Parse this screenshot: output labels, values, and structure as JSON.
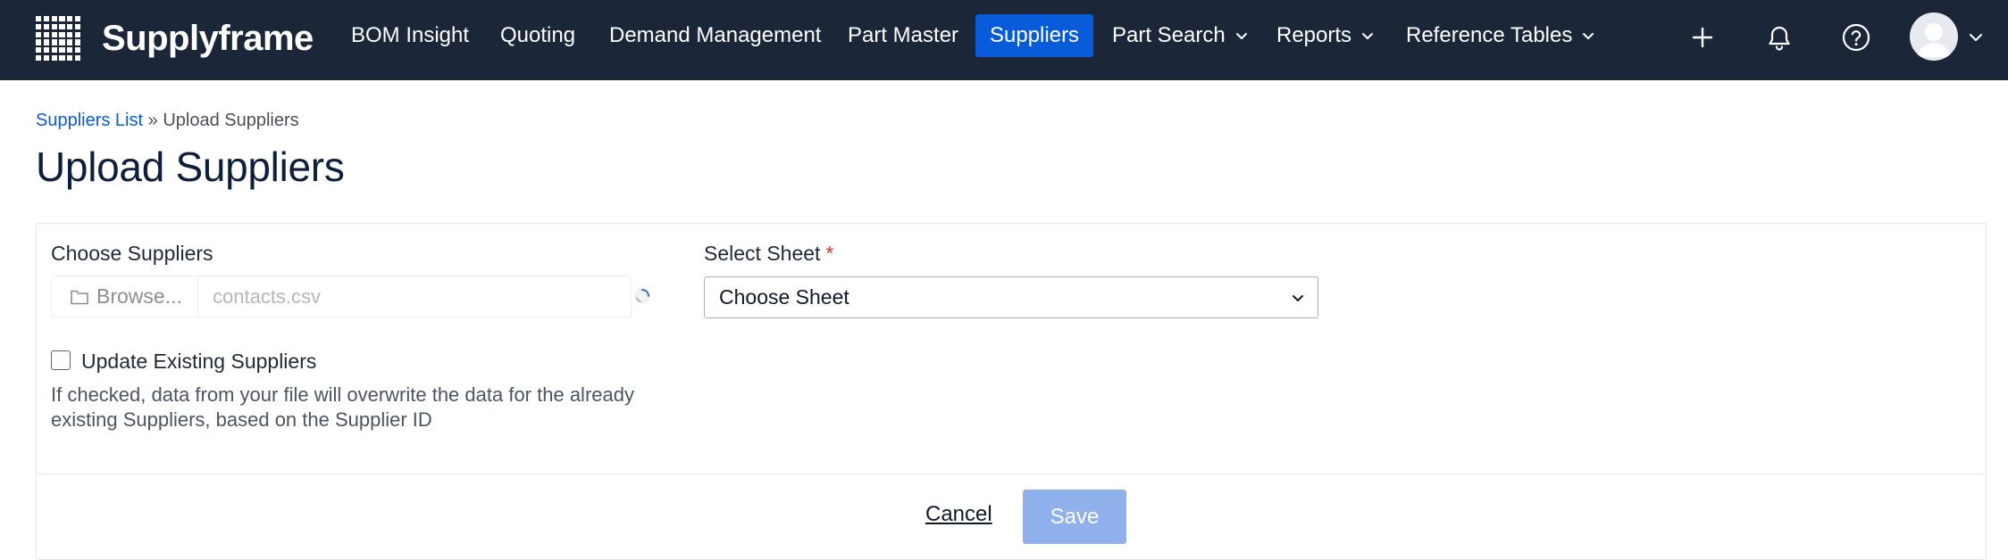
{
  "app": {
    "brand": "Supplyframe",
    "brand_color": "#1b2639",
    "accent_color": "#0a5bd9"
  },
  "nav": {
    "items": [
      {
        "label": "BOM Insight",
        "active": false,
        "dropdown": false
      },
      {
        "label": "Quoting",
        "active": false,
        "dropdown": false
      },
      {
        "label": "Demand Management",
        "active": false,
        "dropdown": false
      },
      {
        "label": "Part Master",
        "active": false,
        "dropdown": false
      },
      {
        "label": "Suppliers",
        "active": true,
        "dropdown": false
      },
      {
        "label": "Part Search",
        "active": false,
        "dropdown": true
      },
      {
        "label": "Reports",
        "active": false,
        "dropdown": true
      },
      {
        "label": "Reference Tables",
        "active": false,
        "dropdown": true
      }
    ],
    "icons": [
      "plus-icon",
      "bell-icon",
      "help-icon",
      "avatar",
      "chevron-down-icon"
    ]
  },
  "breadcrumb": {
    "link": "Suppliers List",
    "separator": " » ",
    "current": "Upload Suppliers"
  },
  "page": {
    "title": "Upload Suppliers"
  },
  "form": {
    "file": {
      "label": "Choose Suppliers",
      "browse_label": "Browse...",
      "file_name": "contacts.csv"
    },
    "sheet": {
      "label": "Select Sheet",
      "required_mark": "*",
      "selected": "Choose Sheet"
    },
    "update": {
      "label": "Update Existing Suppliers",
      "checked": false,
      "help": "If checked, data from your file will overwrite the data for the already existing Suppliers, based on the Supplier ID"
    },
    "actions": {
      "cancel_label": "Cancel",
      "save_label": "Save"
    }
  }
}
